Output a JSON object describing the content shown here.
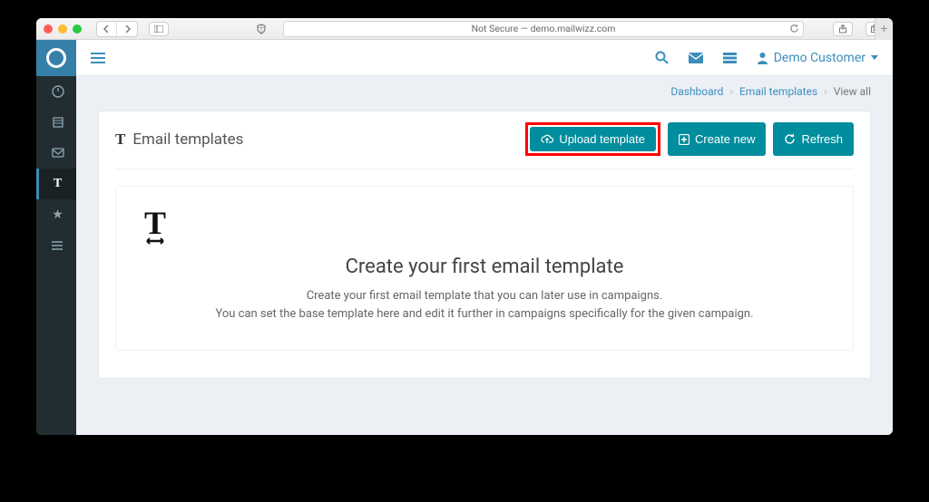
{
  "browser": {
    "address_label": "Not Secure — demo.mailwizz.com"
  },
  "topbar": {
    "username": "Demo Customer"
  },
  "breadcrumbs": {
    "dashboard": "Dashboard",
    "templates": "Email templates",
    "viewall": "View all"
  },
  "panel": {
    "title": "Email templates",
    "upload_label": "Upload template",
    "create_label": "Create new",
    "refresh_label": "Refresh"
  },
  "empty": {
    "heading": "Create your first email template",
    "line1": "Create your first email template that you can later use in campaigns.",
    "line2": "You can set the base template here and edit it further in campaigns specifically for the given campaign."
  }
}
